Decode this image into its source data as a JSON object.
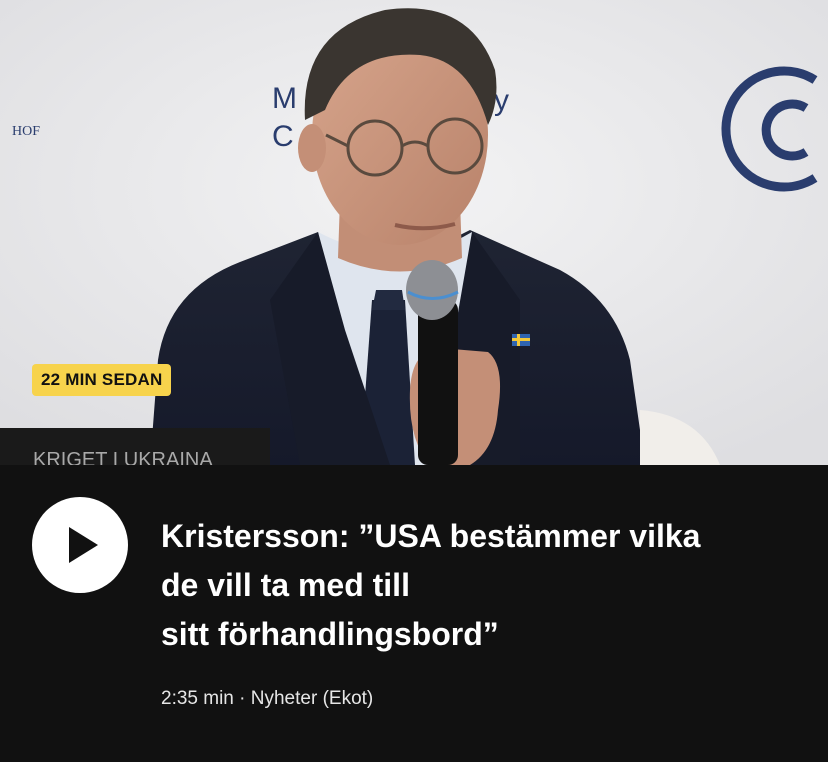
{
  "article": {
    "time_badge": "22 MIN SEDAN",
    "category": "KRIGET I UKRAINA",
    "headline_lines": [
      "Kristersson: ”USA bestämmer vilka",
      "de vill ta med till",
      "sitt förhandlingsbord”"
    ],
    "meta": "2:35 min · Nyheter (Ekot)",
    "play_icon": "play-icon"
  },
  "backdrop": {
    "left_text": "HOF",
    "center_text_top": "M",
    "center_text_top_right": "y",
    "center_text_bottom": "C"
  },
  "colors": {
    "background": "#111111",
    "badge": "#f7d34c",
    "category_tab": "#1a1a1a",
    "category_text": "#a9a9a9",
    "headline": "#ffffff",
    "logo_blue": "#2a3d6e"
  }
}
